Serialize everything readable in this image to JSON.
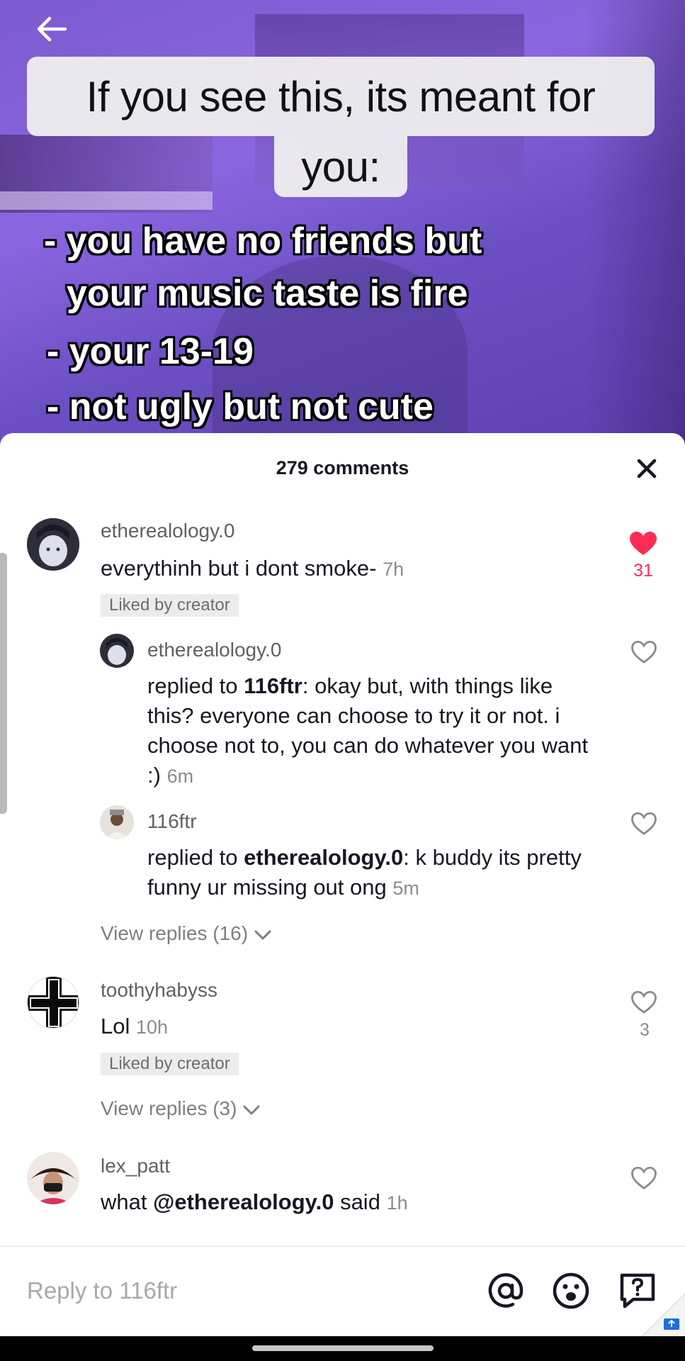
{
  "video": {
    "caption_line1": "If you see this, its meant for",
    "caption_line2": "you:",
    "overlay_lines": [
      "- you have no friends but",
      "your music taste is fire",
      "- your 13-19",
      "- not ugly but not cute"
    ]
  },
  "sheet": {
    "comment_count": "279 comments"
  },
  "comments": [
    {
      "username": "etherealology.0",
      "text": "everythinh but i dont smoke-",
      "time": "7h",
      "badge": "Liked by creator",
      "likes": "31",
      "liked": true,
      "replies": [
        {
          "username": "etherealology.0",
          "prefix": "replied to ",
          "mention": "116ftr",
          "text": ": okay but, with things like this? everyone can choose to try it or not. i choose not to, you can do whatever you want :)",
          "time": "6m"
        },
        {
          "username": "116ftr",
          "prefix": "replied to ",
          "mention": "etherealology.0",
          "text": ": k buddy its pretty funny ur missing out ong",
          "time": "5m"
        }
      ],
      "view_replies": "View replies (16)"
    },
    {
      "username": "toothyhabyss",
      "text": "Lol",
      "time": "10h",
      "badge": "Liked by creator",
      "likes": "3",
      "liked": false,
      "view_replies": "View replies (3)"
    },
    {
      "username": "lex_patt",
      "prefix": "what ",
      "mention": "@etherealology.0",
      "suffix": " said",
      "time": "1h"
    }
  ],
  "input": {
    "placeholder": "Reply to 116ftr"
  },
  "colors": {
    "like_red": "#fe2c55",
    "text_dark": "#161823",
    "muted": "#8a8b91"
  }
}
